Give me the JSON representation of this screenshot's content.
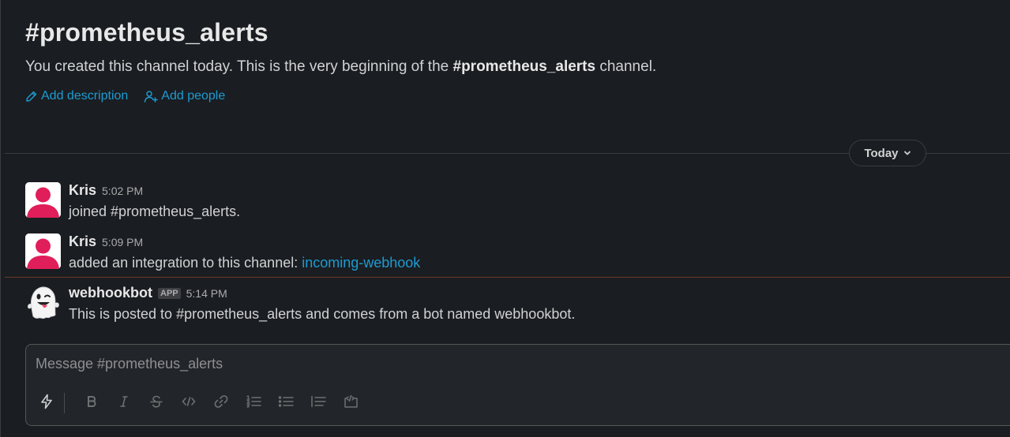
{
  "channel": {
    "title": "#prometheus_alerts",
    "intro_prefix": "You created this channel today. This is the very beginning of the ",
    "intro_channel": "#prometheus_alerts",
    "intro_suffix": " channel.",
    "add_description": "Add description",
    "add_people": "Add people"
  },
  "day_divider": {
    "label": "Today",
    "icon": "chevron-down-icon"
  },
  "messages": [
    {
      "author": "Kris",
      "time": "5:02 PM",
      "text": "joined #prometheus_alerts.",
      "avatar": "user-avatar-icon"
    },
    {
      "author": "Kris",
      "time": "5:09 PM",
      "text": "added an integration to this channel: ",
      "link": "incoming-webhook",
      "avatar": "user-avatar-icon"
    },
    {
      "author": "webhookbot",
      "badge": "APP",
      "time": "5:14 PM",
      "text": "This is posted to #prometheus_alerts and comes from a bot named webhookbot.",
      "avatar": "ghost-icon"
    }
  ],
  "composer": {
    "placeholder": "Message #prometheus_alerts",
    "toolbar": [
      "shortcuts-icon",
      "bold-icon",
      "italic-icon",
      "strikethrough-icon",
      "code-icon",
      "link-icon",
      "ordered-list-icon",
      "bulleted-list-icon",
      "blockquote-icon",
      "code-block-icon"
    ]
  },
  "colors": {
    "background": "#1a1d21",
    "link": "#1d9bd1",
    "avatar": "#e01e5a",
    "new_message_line": "#6e3a28"
  }
}
